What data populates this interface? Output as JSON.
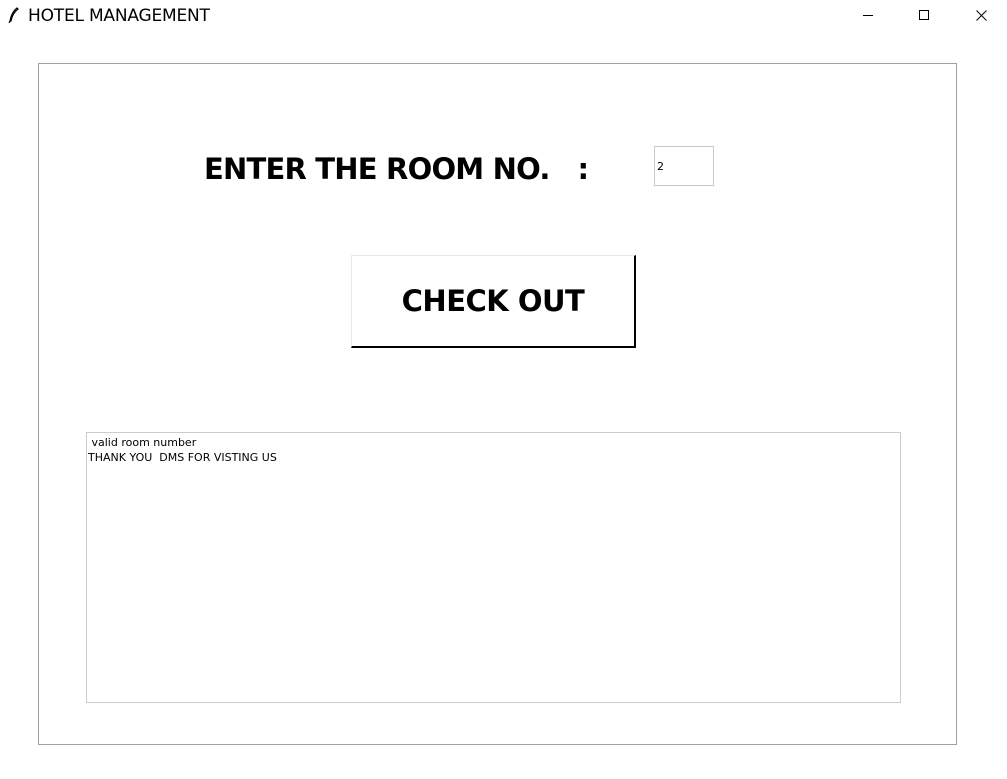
{
  "window": {
    "title": "HOTEL MANAGEMENT",
    "icon": "feather-icon",
    "controls": [
      "minimize-icon",
      "maximize-icon",
      "close-icon"
    ]
  },
  "form": {
    "room_label": "ENTER THE ROOM NO.   :",
    "room_value": "2",
    "checkout_label": "CHECK OUT"
  },
  "output": {
    "lines": [
      " valid room number",
      "THANK YOU  DMS FOR VISTING US"
    ]
  },
  "colors": {
    "background": "#ffffff",
    "frame_border": "#a0a0a0",
    "text": "#000000"
  }
}
